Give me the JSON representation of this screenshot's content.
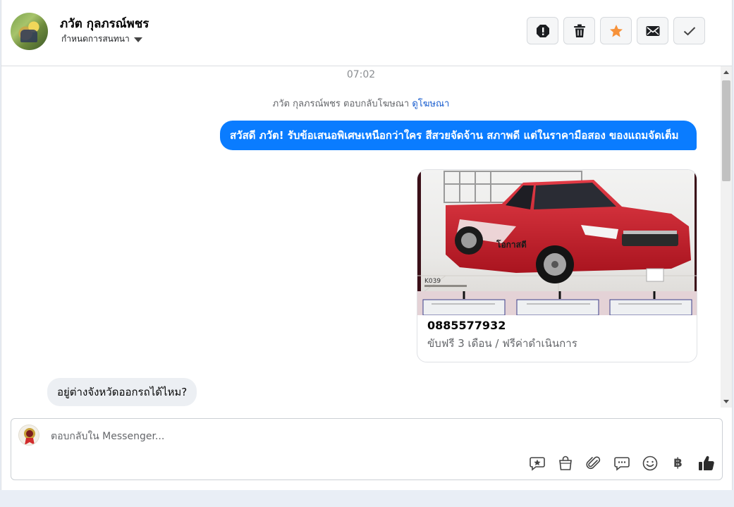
{
  "header": {
    "contact_name": "ภวัต กุลภรณ์พชร",
    "assign_label": "กำหนดการสนทนา",
    "actions": [
      "report-icon",
      "trash-icon",
      "star-icon",
      "mail-icon",
      "check-icon"
    ],
    "star_color": "#f7923a"
  },
  "conversation": {
    "timestamp": "07:02",
    "ad_reply_text": "ภวัต กุลภรณ์พชร ตอบกลับโฆษณา",
    "ad_link_label": "ดูโฆษณา",
    "outgoing_message": "สวัสดี ภวัต! รับข้อเสนอพิเศษเหนือกว่าใคร สีสวยจัดจ้าน สภาพดี แต่ในราคามือสอง ของแถมจัดเต็ม",
    "ad_card": {
      "phone": "0885577932",
      "subtitle": "ขับฟรี 3 เดือน / ฟรีค่าดำเนินการ",
      "image_code": "K039"
    },
    "incoming_message": "อยู่ต่างจังหวัดออกรถได้ไหม?"
  },
  "composer": {
    "placeholder": "ตอบกลับใน Messenger...",
    "tools": [
      "saved-reply-icon",
      "shop-bag-icon",
      "attachment-icon",
      "chat-bubble-icon",
      "emoji-icon",
      "baht-icon",
      "like-icon"
    ],
    "baht_symbol": "฿"
  },
  "colors": {
    "outgoing_bubble": "#0a7cff",
    "incoming_bubble": "#eceff3",
    "link": "#1b5fcf"
  }
}
